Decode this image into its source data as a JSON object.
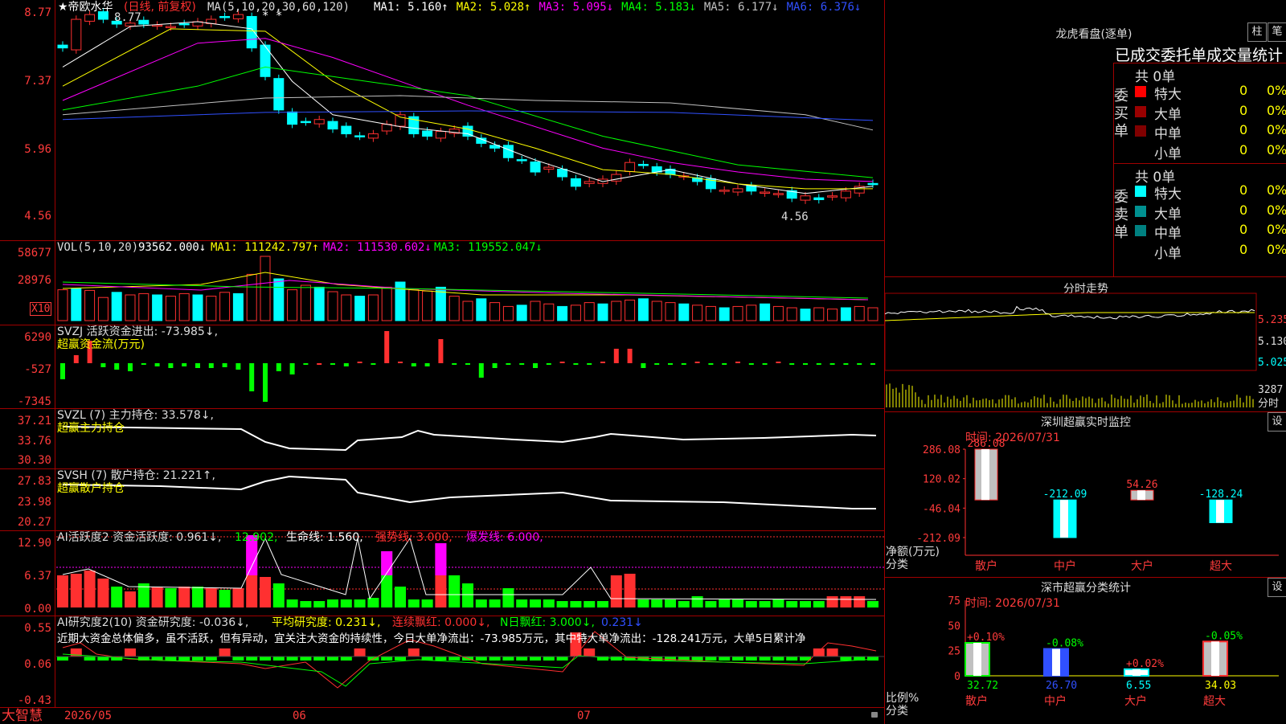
{
  "main": {
    "title": "★帝欧水华",
    "period": "(日线, 前复权)",
    "ma_label": "MA(5,10,20,30,60,120)",
    "ma_items": [
      {
        "text": "MA1: 5.160↑",
        "color": "#ffffff"
      },
      {
        "text": "MA2: 5.028↑",
        "color": "#ffff00"
      },
      {
        "text": "MA3: 5.095↓",
        "color": "#ff00ff"
      },
      {
        "text": "MA4: 5.183↓",
        "color": "#00ff00"
      },
      {
        "text": "MA5: 6.177↓",
        "color": "#c0c0c0"
      },
      {
        "text": "MA6: 6.376↓",
        "color": "#3050ff"
      }
    ],
    "y_ticks": [
      "8.77",
      "7.37",
      "5.96",
      "4.56"
    ],
    "annot_high": "8.77",
    "annot_low": "4.56",
    "stars": "* *"
  },
  "vol": {
    "label": "VOL(5,10,20)",
    "value": "93562.000↓",
    "ma1": "MA1: 111242.797↑",
    "ma2": "MA2: 111530.602↓",
    "ma3": "MA3: 119552.047↓",
    "y_ticks": [
      "58677",
      "28976"
    ],
    "unit": "X10"
  },
  "svzj": {
    "label": "SVZJ  活跃资金进出: -73.985↓,",
    "sub": "超赢资金流(万元)",
    "y_ticks": [
      "6290",
      "-527",
      "-7345"
    ]
  },
  "svzl": {
    "label": "SVZL (7) 主力持仓: 33.578↓,",
    "sub": "超赢主力持仓",
    "y_ticks": [
      "37.21",
      "33.76",
      "30.30"
    ]
  },
  "svsh": {
    "label": "SVSH (7) 散户持仓: 21.221↑,",
    "sub": "超赢散户持仓",
    "y_ticks": [
      "27.83",
      "23.98",
      "20.27"
    ]
  },
  "ai1": {
    "label": "AI活跃度2 资金活跃度: 0.961↓,",
    "v2": "12.902,",
    "v3": "生命线: 1.560,",
    "v4": "强势线: 3.000,",
    "v5": "爆发线: 6.000,",
    "y_ticks": [
      "12.90",
      "6.37",
      "0.00"
    ]
  },
  "ai2": {
    "label": "AI研究度2(10) 资金研究度: -0.036↓,",
    "v2": "平均研究度: 0.231↓,",
    "v3": "连续飘红: 0.000↓,",
    "v4": "N日飘红: 3.000↓,",
    "v5": "0.231↓",
    "text": "近期大资金总体偏多，虽不活跃，但有异动，宜关注大资金的持续性，今日大单净流出：-73.985万元，其中特大单净流出：-128.241万元，大单5日累计净",
    "y_ticks": [
      "0.55",
      "0.06",
      "-0.43"
    ]
  },
  "bottom": {
    "brand": "大智慧",
    "dates": [
      "2026/05",
      "06",
      "07"
    ]
  },
  "lhb": {
    "title": "龙虎看盘(逐单)",
    "btn1": "柱",
    "btn2": "笔",
    "header": "已成交委托单成交量统计",
    "buy_label": "委买单",
    "sell_label": "委卖单",
    "buy_total": "共 0单",
    "sell_total": "共 0单",
    "buy_rows": [
      {
        "name": "特大",
        "count": "0",
        "pct": "0%",
        "color": "#ff0000"
      },
      {
        "name": "大单",
        "count": "0",
        "pct": "0%",
        "color": "#990000"
      },
      {
        "name": "中单",
        "count": "0",
        "pct": "0%",
        "color": "#800000"
      },
      {
        "name": "小单",
        "count": "0",
        "pct": "0%",
        "color": "#000000"
      }
    ],
    "sell_rows": [
      {
        "name": "特大",
        "count": "0",
        "pct": "0%",
        "color": "#00ffff"
      },
      {
        "name": "大单",
        "count": "0",
        "pct": "0%",
        "color": "#009090"
      },
      {
        "name": "中单",
        "count": "0",
        "pct": "0%",
        "color": "#008080"
      },
      {
        "name": "小单",
        "count": "0",
        "pct": "0%",
        "color": "#000000"
      }
    ]
  },
  "intraday": {
    "title": "分时走势",
    "y_ticks": [
      "5.235",
      "5.130",
      "5.025"
    ],
    "vol_tick": "3287",
    "vol_label": "分时"
  },
  "sz_monitor": {
    "title": "深圳超赢实时监控",
    "btn": "设",
    "time": "时间: 2026/07/31",
    "y_ticks": [
      "286.08",
      "120.02",
      "-46.04",
      "-212.09"
    ],
    "axis_name": "净额(万元)",
    "axis_cat": "分类",
    "bars": [
      {
        "cat": "散户",
        "value": 286.08,
        "label": "286.08"
      },
      {
        "cat": "中户",
        "value": -212.09,
        "label": "-212.09"
      },
      {
        "cat": "大户",
        "value": 54.26,
        "label": "54.26"
      },
      {
        "cat": "超大",
        "value": -128.24,
        "label": "-128.24"
      }
    ]
  },
  "sz_class": {
    "title": "深市超赢分类统计",
    "btn": "设",
    "time": "时间: 2026/07/31",
    "y_ticks": [
      "75",
      "50",
      "25",
      "0"
    ],
    "axis_name": "比例%",
    "axis_cat": "分类",
    "bars": [
      {
        "cat": "散户",
        "value": 32.72,
        "label": "32.72",
        "chg": "+0.10%"
      },
      {
        "cat": "中户",
        "value": 26.7,
        "label": "26.70",
        "chg": "-0.08%"
      },
      {
        "cat": "大户",
        "value": 6.55,
        "label": "6.55",
        "chg": "+0.02%"
      },
      {
        "cat": "超大",
        "value": 34.03,
        "label": "34.03",
        "chg": "-0.05%"
      }
    ]
  },
  "chart_data": [
    {
      "type": "bar",
      "title": "深圳超赢实时监控",
      "categories": [
        "散户",
        "中户",
        "大户",
        "超大"
      ],
      "values": [
        286.08,
        -212.09,
        54.26,
        -128.24
      ],
      "ylabel": "净额(万元)",
      "ylim": [
        -212.09,
        286.08
      ]
    },
    {
      "type": "bar",
      "title": "深市超赢分类统计",
      "categories": [
        "散户",
        "中户",
        "大户",
        "超大"
      ],
      "values": [
        32.72,
        26.7,
        6.55,
        34.03
      ],
      "ylabel": "比例%",
      "ylim": [
        0,
        75
      ]
    }
  ]
}
